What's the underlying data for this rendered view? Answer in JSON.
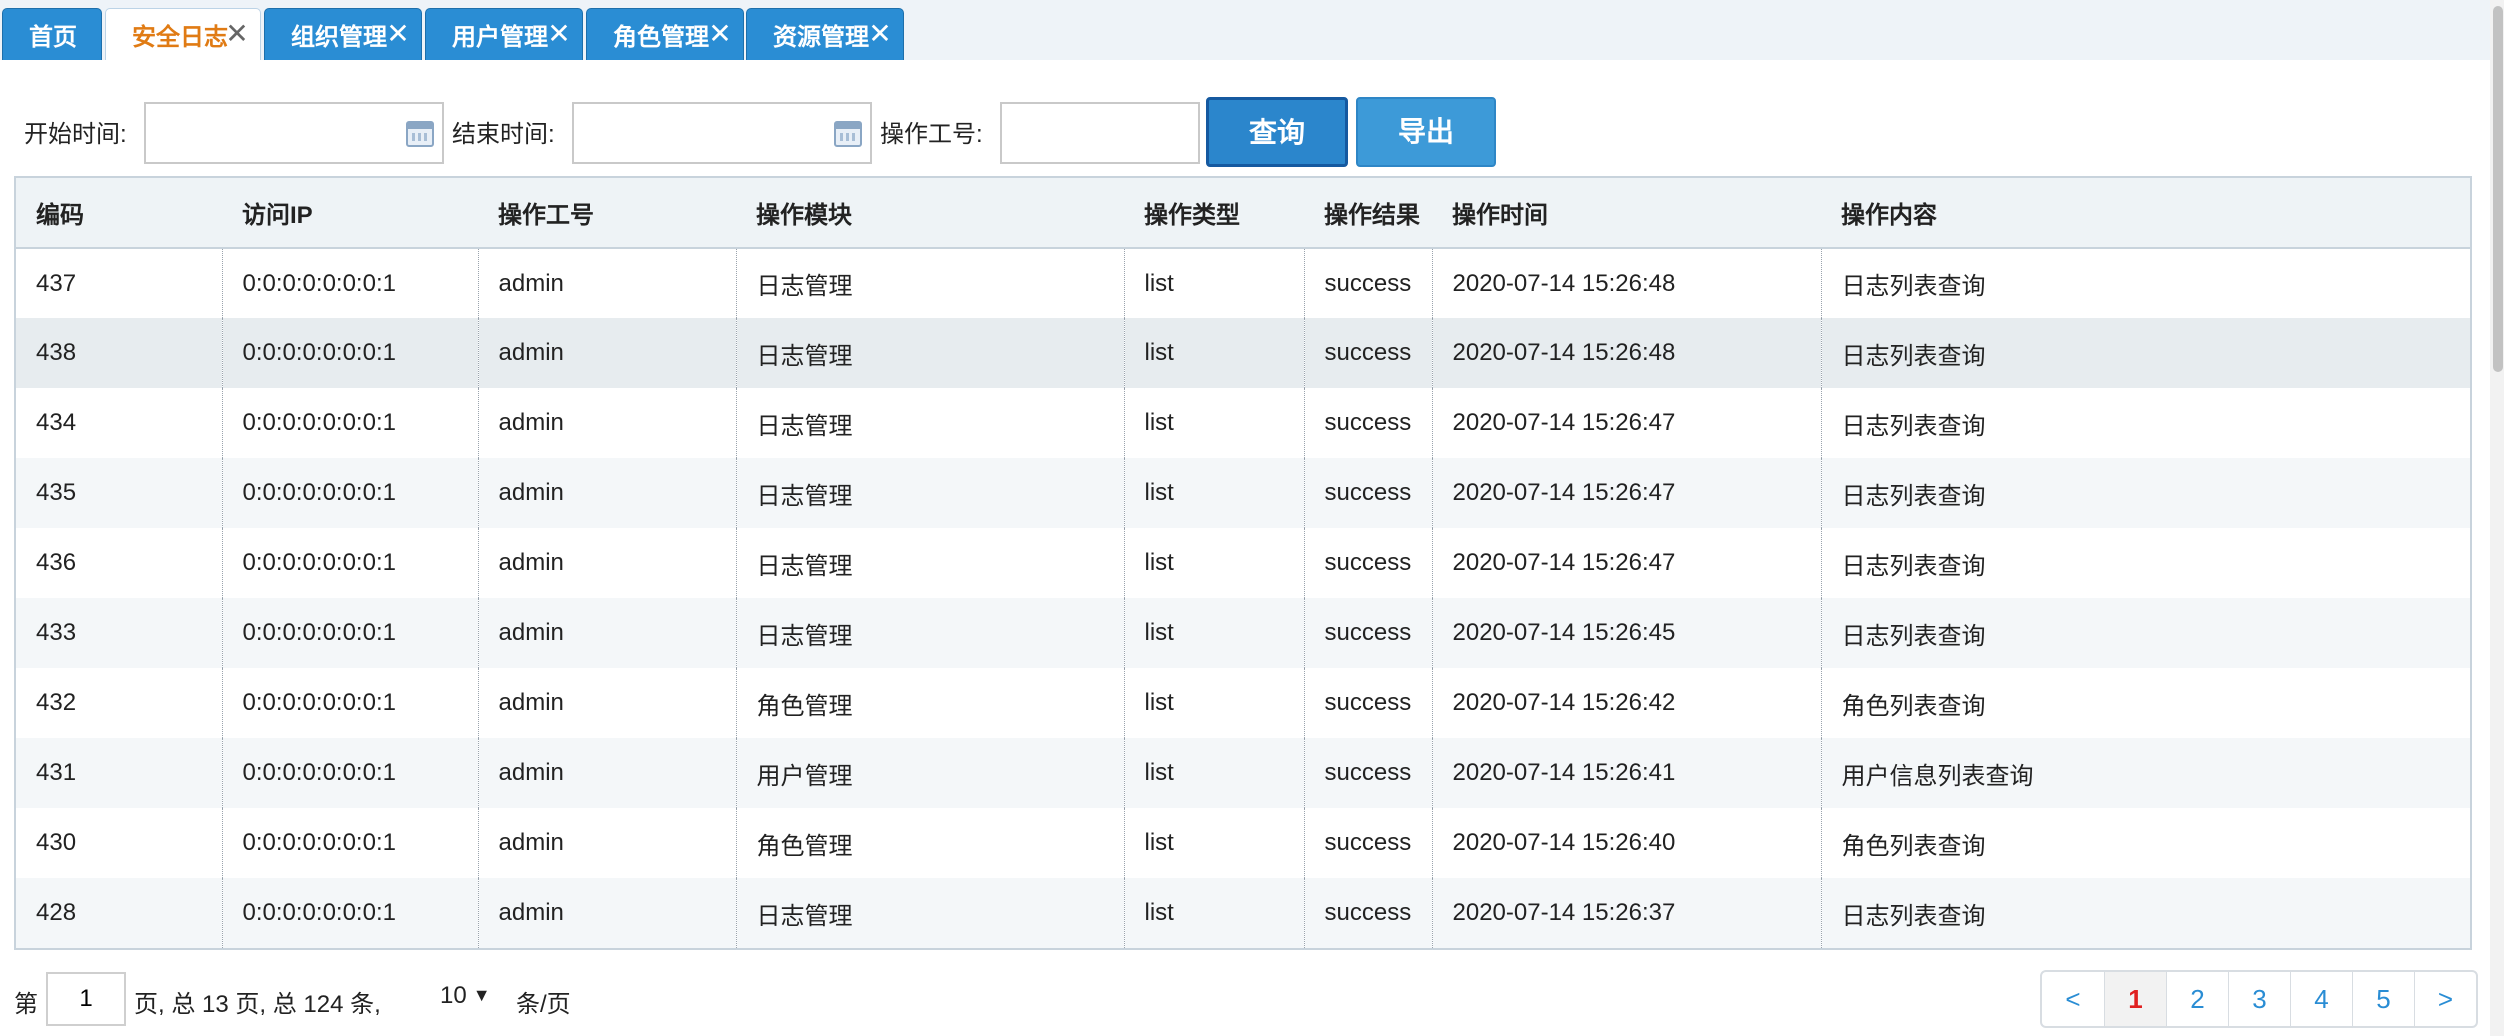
{
  "tabs": [
    {
      "label": "首页",
      "active": false,
      "closable": false
    },
    {
      "label": "安全日志",
      "active": true,
      "closable": true
    },
    {
      "label": "组织管理",
      "active": false,
      "closable": true
    },
    {
      "label": "用户管理",
      "active": false,
      "closable": true
    },
    {
      "label": "角色管理",
      "active": false,
      "closable": true
    },
    {
      "label": "资源管理",
      "active": false,
      "closable": true
    }
  ],
  "close_glyph": "✕",
  "search": {
    "start_label": "开始时间:",
    "start_value": "",
    "end_label": "结束时间:",
    "end_value": "",
    "operator_label": "操作工号:",
    "operator_value": "",
    "query_button": "查询",
    "export_button": "导出"
  },
  "table": {
    "headers": [
      "编码",
      "访问IP",
      "操作工号",
      "操作模块",
      "操作类型",
      "操作结果",
      "操作时间",
      "操作内容"
    ],
    "rows": [
      [
        "437",
        "0:0:0:0:0:0:0:1",
        "admin",
        "日志管理",
        "list",
        "success",
        "2020-07-14 15:26:48",
        "日志列表查询"
      ],
      [
        "438",
        "0:0:0:0:0:0:0:1",
        "admin",
        "日志管理",
        "list",
        "success",
        "2020-07-14 15:26:48",
        "日志列表查询"
      ],
      [
        "434",
        "0:0:0:0:0:0:0:1",
        "admin",
        "日志管理",
        "list",
        "success",
        "2020-07-14 15:26:47",
        "日志列表查询"
      ],
      [
        "435",
        "0:0:0:0:0:0:0:1",
        "admin",
        "日志管理",
        "list",
        "success",
        "2020-07-14 15:26:47",
        "日志列表查询"
      ],
      [
        "436",
        "0:0:0:0:0:0:0:1",
        "admin",
        "日志管理",
        "list",
        "success",
        "2020-07-14 15:26:47",
        "日志列表查询"
      ],
      [
        "433",
        "0:0:0:0:0:0:0:1",
        "admin",
        "日志管理",
        "list",
        "success",
        "2020-07-14 15:26:45",
        "日志列表查询"
      ],
      [
        "432",
        "0:0:0:0:0:0:0:1",
        "admin",
        "角色管理",
        "list",
        "success",
        "2020-07-14 15:26:42",
        "角色列表查询"
      ],
      [
        "431",
        "0:0:0:0:0:0:0:1",
        "admin",
        "用户管理",
        "list",
        "success",
        "2020-07-14 15:26:41",
        "用户信息列表查询"
      ],
      [
        "430",
        "0:0:0:0:0:0:0:1",
        "admin",
        "角色管理",
        "list",
        "success",
        "2020-07-14 15:26:40",
        "角色列表查询"
      ],
      [
        "428",
        "0:0:0:0:0:0:0:1",
        "admin",
        "日志管理",
        "list",
        "success",
        "2020-07-14 15:26:37",
        "日志列表查询"
      ]
    ],
    "highlighted_row": 1
  },
  "pagination": {
    "prefix": "第",
    "current_page": "1",
    "summary": "页, 总 13 页, 总 124 条,",
    "page_size": "10",
    "page_size_suffix": "条/页",
    "prev": "<",
    "next": ">",
    "pages": [
      "1",
      "2",
      "3",
      "4",
      "5"
    ]
  },
  "colors": {
    "tab_bg": "#2a8dd4",
    "active_tab_text": "#e07b14",
    "query_button": "#2b86cc",
    "current_page": "#e02020"
  }
}
